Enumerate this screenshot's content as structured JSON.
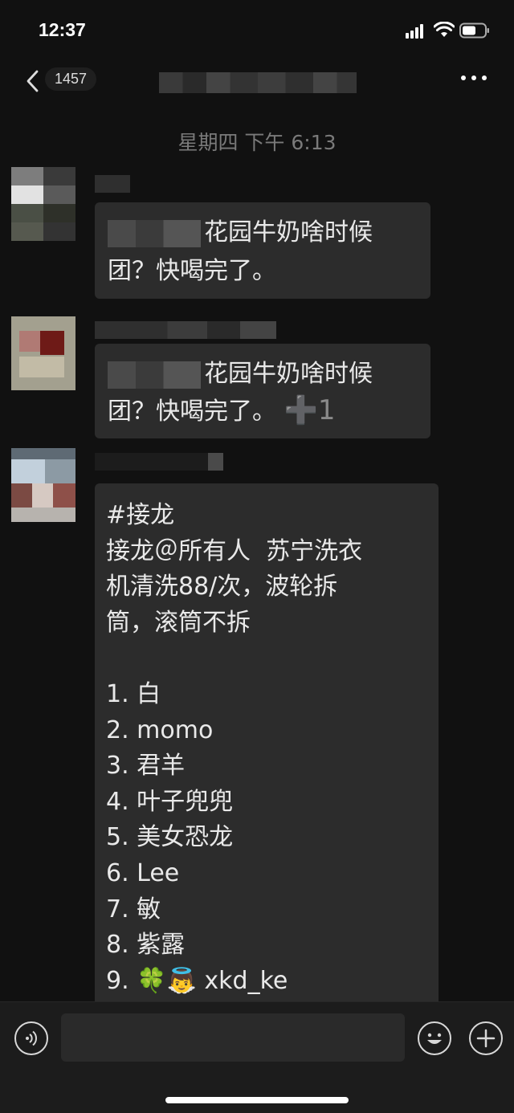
{
  "status": {
    "time": "12:37"
  },
  "nav": {
    "unread_count": "1457"
  },
  "chat": {
    "timestamp": "星期四 下午 6:13",
    "messages": [
      {
        "line1": "花园牛奶啥时候",
        "line2": "团？快喝完了。"
      },
      {
        "line1": "花园牛奶啥时候",
        "line2": "团？快喝完了。",
        "plus": "➕1"
      },
      {
        "text": "#接龙\n接龙＠所有人  苏宁洗衣\n机清洗88/次，波轮拆\n筒，滚筒不拆\n\n1. 白\n2. momo\n3. 君羊\n4. 叶子兜兜\n5. 美女恐龙\n6. Lee\n7. 敏\n8. 紫露\n9. 🍀👼 xkd_ke"
      }
    ]
  },
  "icons": {
    "back": "chevron-left-icon",
    "more": "more-dots-icon",
    "voice": "voice-icon",
    "emoji": "emoji-icon",
    "plus": "plus-icon"
  },
  "colors": {
    "background": "#111111",
    "bubble": "#2c2c2c",
    "timestamp": "#7a7a7a"
  }
}
